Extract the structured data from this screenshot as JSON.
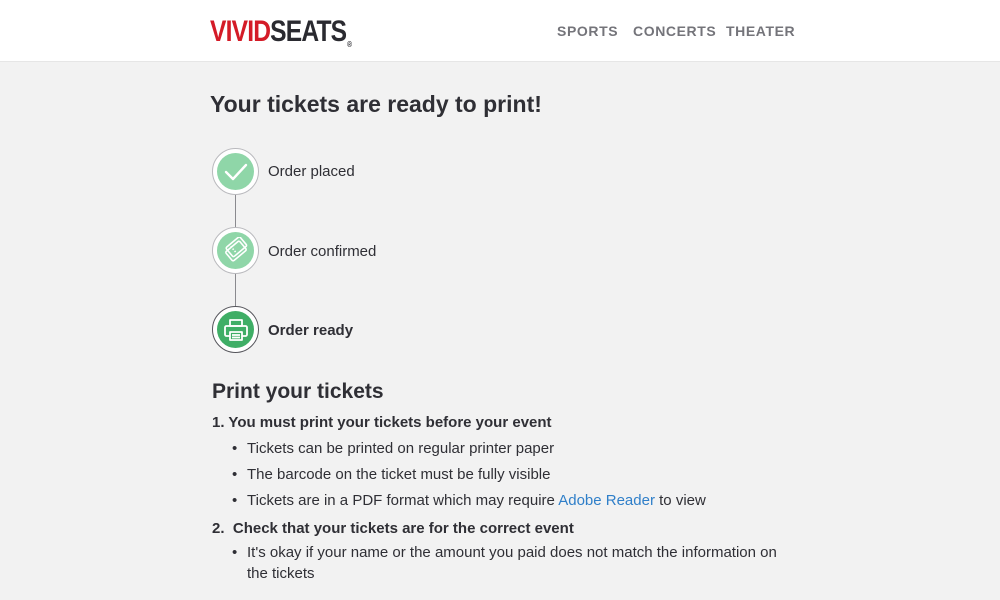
{
  "header": {
    "logo_vivid": "VIVID",
    "logo_seats": "SEATS",
    "logo_reg": "®",
    "nav": [
      "SPORTS",
      "CONCERTS",
      "THEATER"
    ]
  },
  "page_title": "Your tickets are ready to print!",
  "steps": [
    {
      "label": "Order placed",
      "icon": "check-icon",
      "state": "complete"
    },
    {
      "label": "Order confirmed",
      "icon": "tickets-icon",
      "state": "complete"
    },
    {
      "label": "Order ready",
      "icon": "printer-icon",
      "state": "current"
    }
  ],
  "print_section": {
    "title": "Print your tickets",
    "items": [
      {
        "number": "1.",
        "title": "You must print your tickets before your event",
        "bullets": [
          "Tickets can be printed on regular printer paper",
          "The barcode on the ticket must be fully visible"
        ],
        "bullet_with_link": {
          "before": "Tickets are in a PDF format which may require ",
          "link": "Adobe Reader",
          "after": " to view"
        }
      },
      {
        "number": "2.",
        "title": "Check that your tickets are for the correct event",
        "bullets": [
          "It's okay if your name or the amount you paid does not match the information on the tickets"
        ]
      }
    ]
  },
  "colors": {
    "brand_red": "#d41b27",
    "step_light_green": "#8fd6a8",
    "step_dark_green": "#3fae66",
    "link_blue": "#2f7fc9"
  }
}
